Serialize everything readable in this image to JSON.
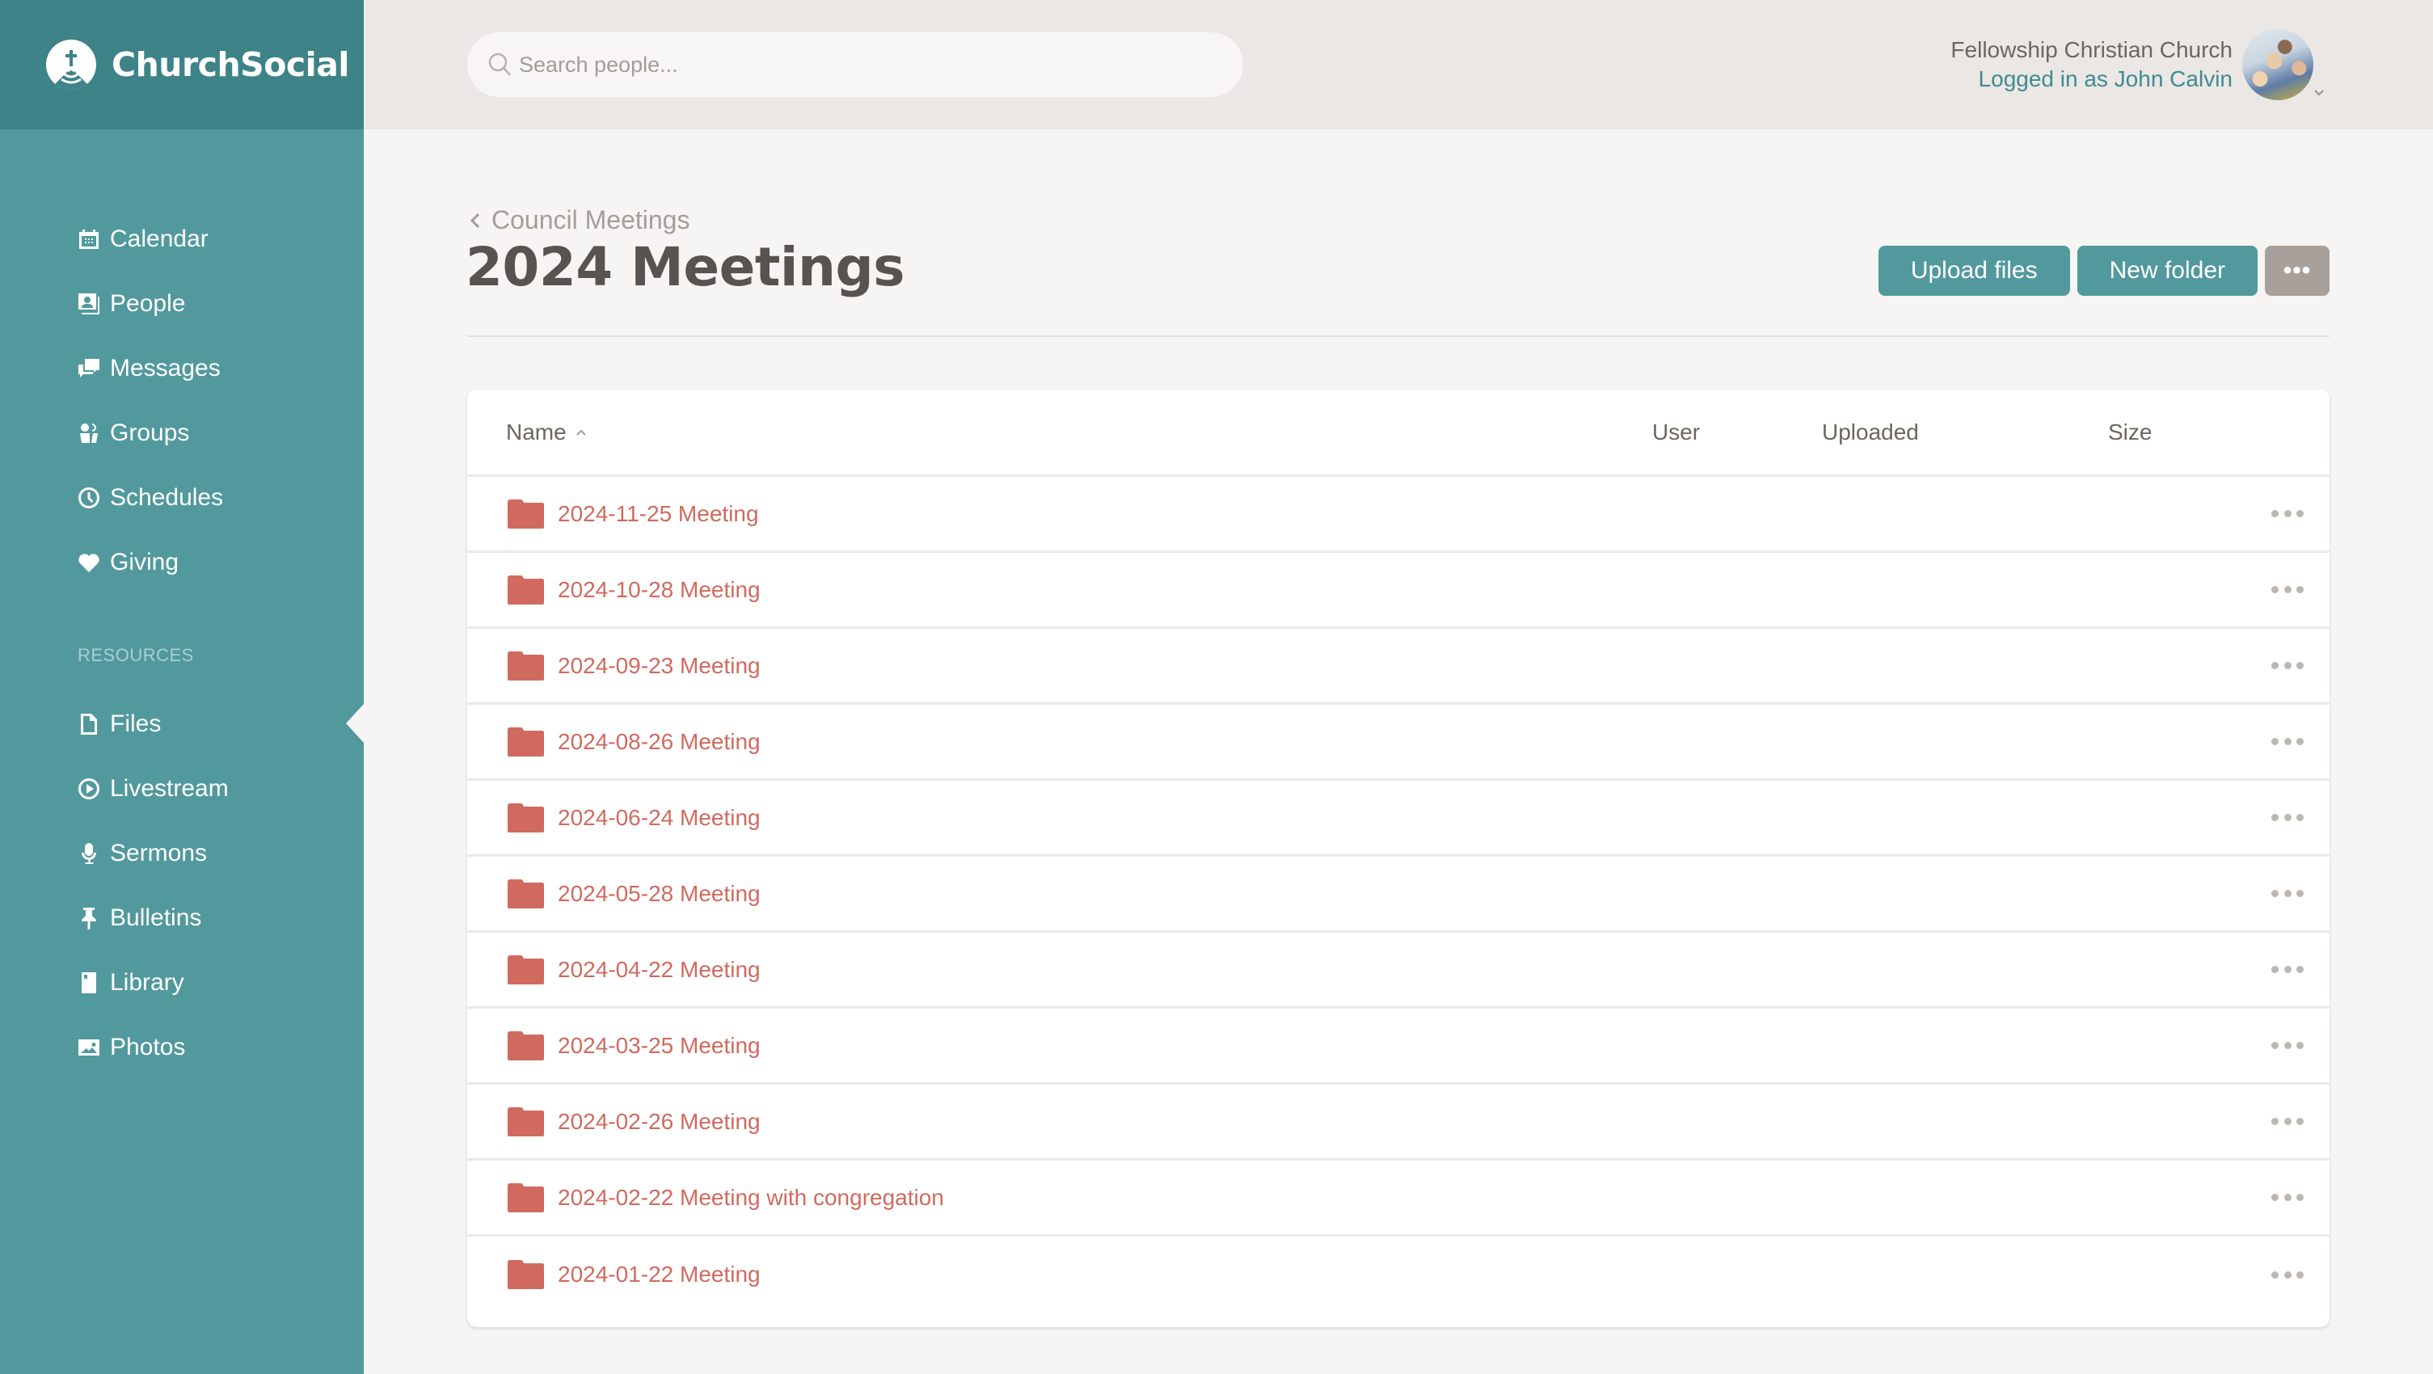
{
  "brand": {
    "name": "ChurchSocial",
    "logo_icon": "church-cross-icon"
  },
  "colors": {
    "sidebar": "#52999e",
    "sidebar_brand": "#3d8388",
    "accent": "#52999e",
    "folder": "#d06a5e",
    "muted_button": "#a8a09a"
  },
  "sidebar": {
    "main_items": [
      {
        "label": "Calendar",
        "icon": "calendar-icon"
      },
      {
        "label": "People",
        "icon": "people-icon"
      },
      {
        "label": "Messages",
        "icon": "messages-icon"
      },
      {
        "label": "Groups",
        "icon": "groups-icon"
      },
      {
        "label": "Schedules",
        "icon": "clock-icon"
      },
      {
        "label": "Giving",
        "icon": "heart-icon"
      }
    ],
    "section_label": "RESOURCES",
    "resource_items": [
      {
        "label": "Files",
        "icon": "file-icon",
        "active": true
      },
      {
        "label": "Livestream",
        "icon": "play-circle-icon"
      },
      {
        "label": "Sermons",
        "icon": "microphone-icon"
      },
      {
        "label": "Bulletins",
        "icon": "pin-icon"
      },
      {
        "label": "Library",
        "icon": "book-icon"
      },
      {
        "label": "Photos",
        "icon": "image-icon"
      }
    ]
  },
  "header": {
    "search_placeholder": "Search people...",
    "search_value": "",
    "church_name": "Fellowship Christian Church",
    "logged_in_text": "Logged in as John Calvin"
  },
  "page": {
    "breadcrumb": "Council Meetings",
    "title": "2024 Meetings",
    "buttons": {
      "upload": "Upload files",
      "new_folder": "New folder",
      "more": "•••"
    }
  },
  "table": {
    "columns": {
      "name": "Name",
      "user": "User",
      "uploaded": "Uploaded",
      "size": "Size"
    },
    "sort": {
      "column": "Name",
      "direction": "ascending"
    },
    "rows": [
      {
        "name": "2024-11-25 Meeting",
        "type": "folder",
        "user": "",
        "uploaded": "",
        "size": ""
      },
      {
        "name": "2024-10-28 Meeting",
        "type": "folder",
        "user": "",
        "uploaded": "",
        "size": ""
      },
      {
        "name": "2024-09-23 Meeting",
        "type": "folder",
        "user": "",
        "uploaded": "",
        "size": ""
      },
      {
        "name": "2024-08-26 Meeting",
        "type": "folder",
        "user": "",
        "uploaded": "",
        "size": ""
      },
      {
        "name": "2024-06-24 Meeting",
        "type": "folder",
        "user": "",
        "uploaded": "",
        "size": ""
      },
      {
        "name": "2024-05-28 Meeting",
        "type": "folder",
        "user": "",
        "uploaded": "",
        "size": ""
      },
      {
        "name": "2024-04-22 Meeting",
        "type": "folder",
        "user": "",
        "uploaded": "",
        "size": ""
      },
      {
        "name": "2024-03-25 Meeting",
        "type": "folder",
        "user": "",
        "uploaded": "",
        "size": ""
      },
      {
        "name": "2024-02-26 Meeting",
        "type": "folder",
        "user": "",
        "uploaded": "",
        "size": ""
      },
      {
        "name": "2024-02-22 Meeting with congregation",
        "type": "folder",
        "user": "",
        "uploaded": "",
        "size": ""
      },
      {
        "name": "2024-01-22 Meeting",
        "type": "folder",
        "user": "",
        "uploaded": "",
        "size": ""
      }
    ]
  }
}
